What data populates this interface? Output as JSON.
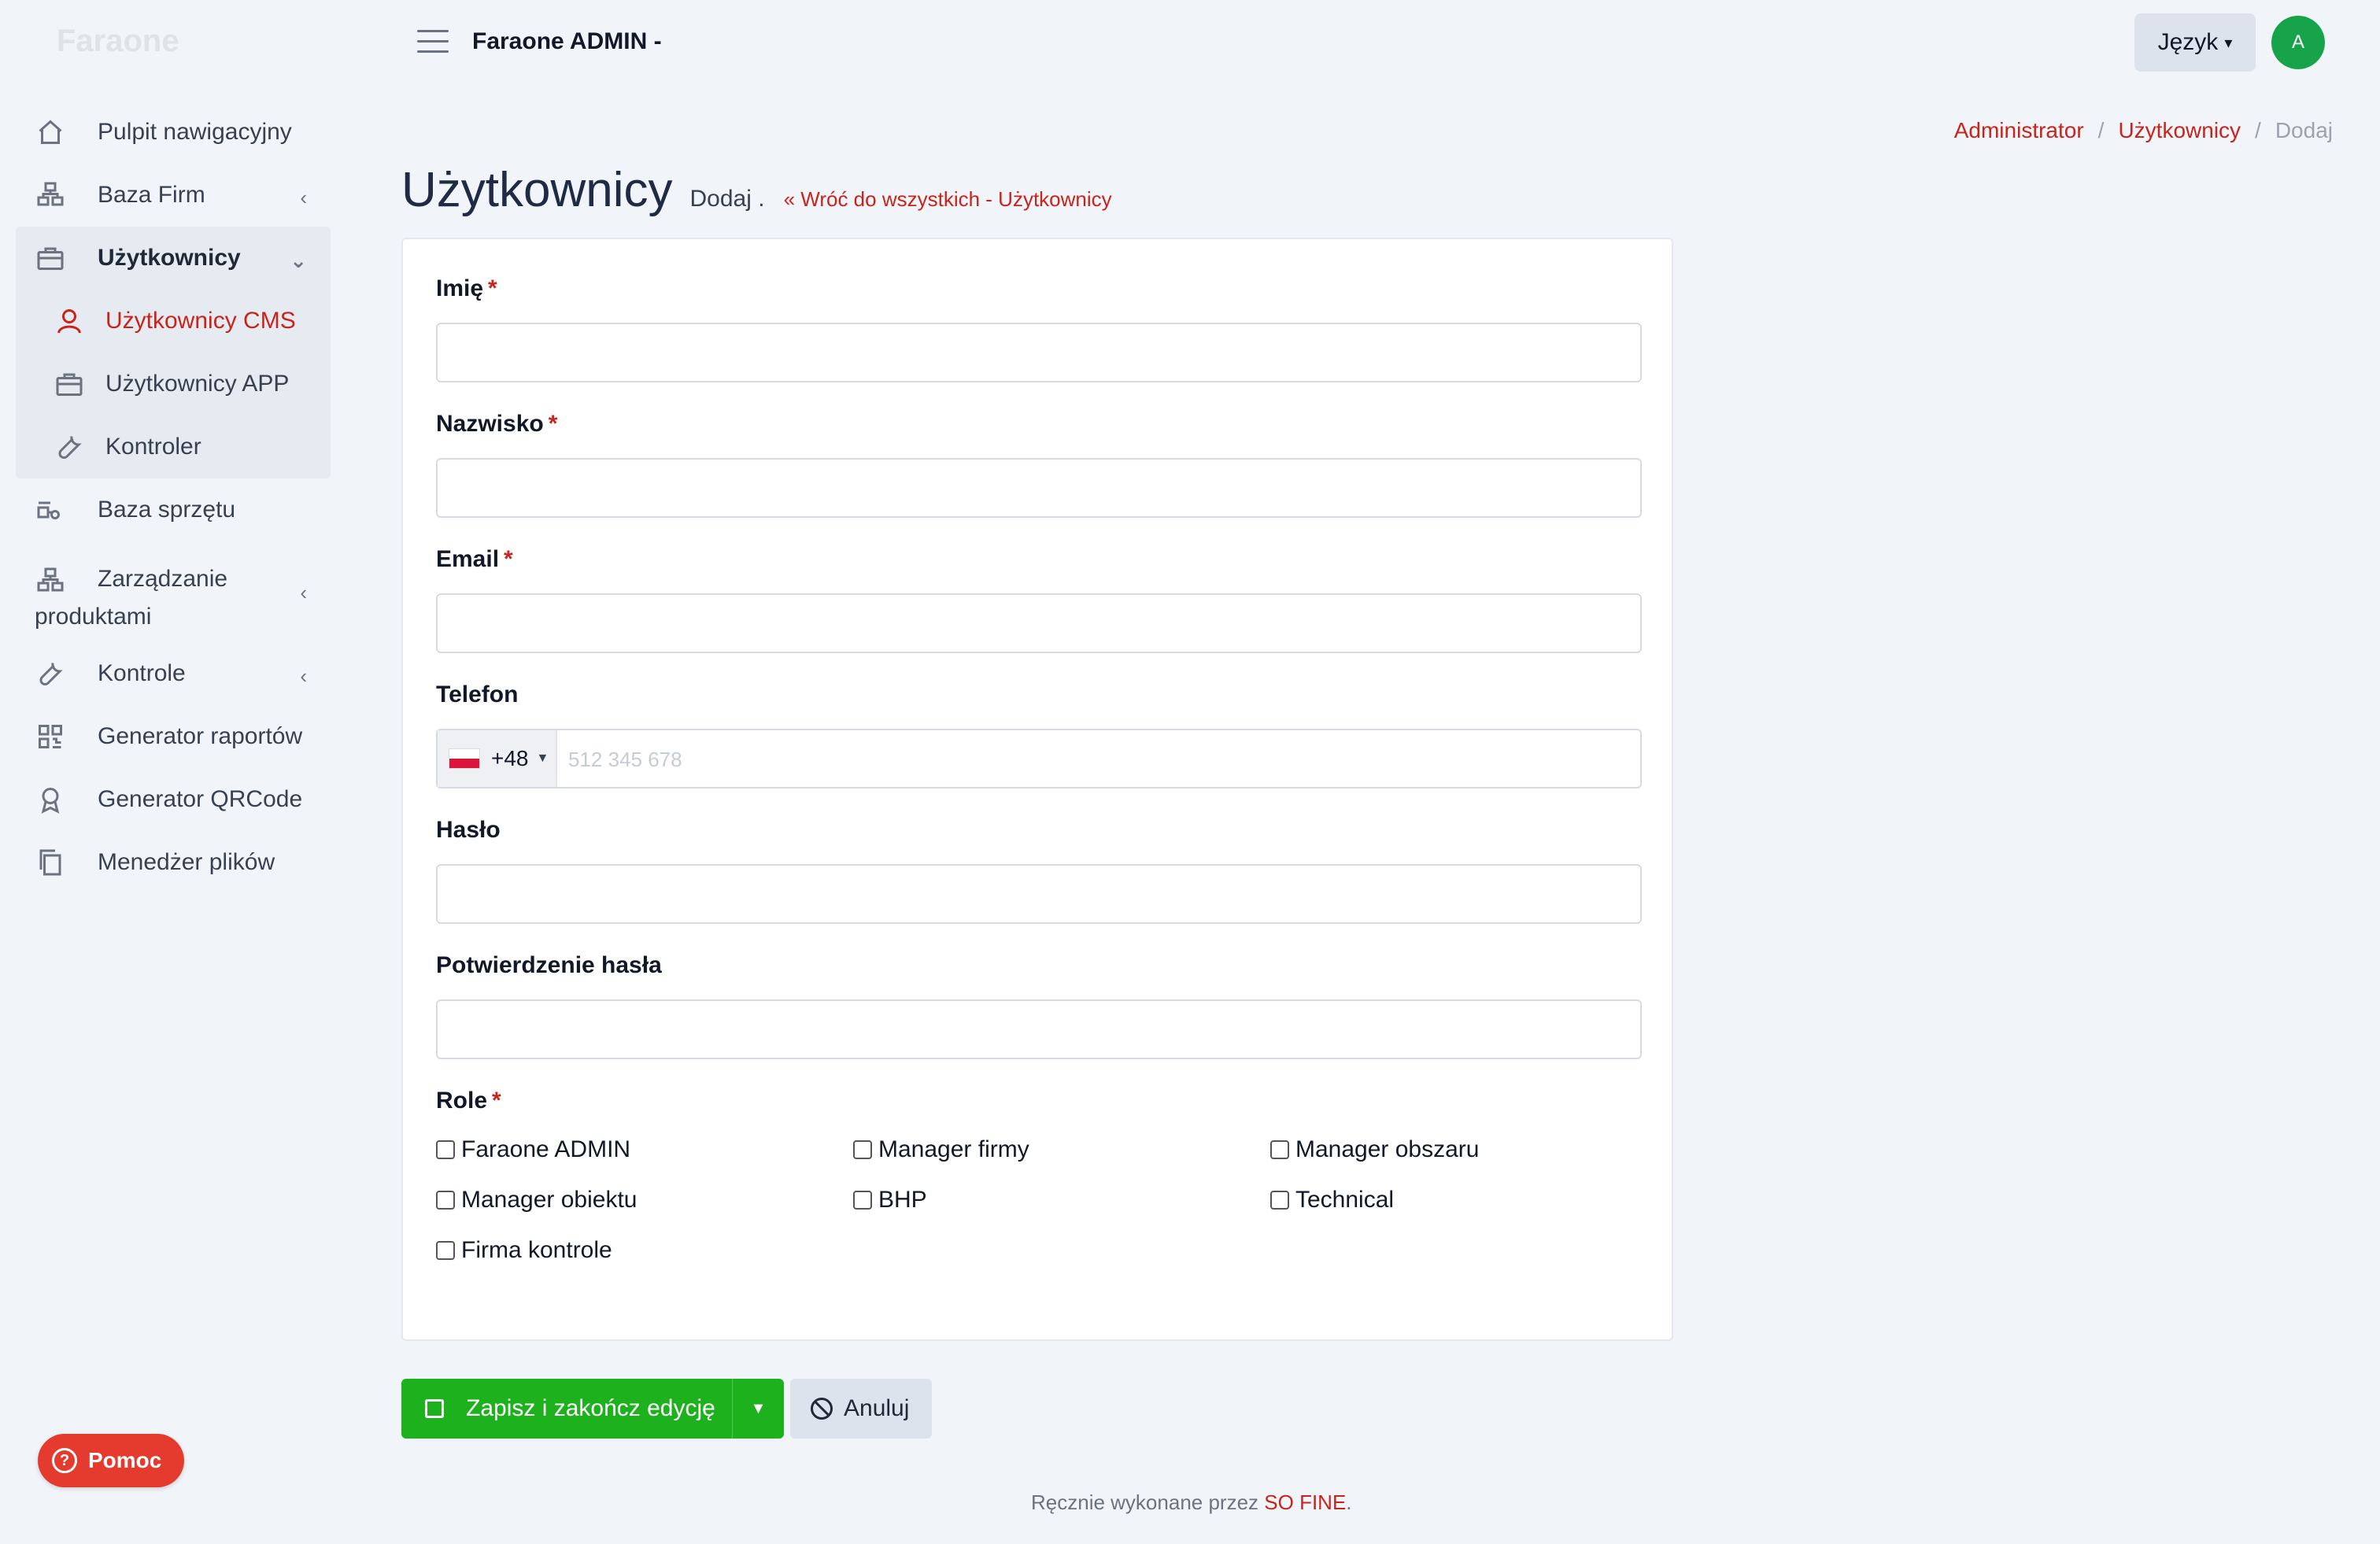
{
  "brand": "Faraone",
  "topbar": {
    "title": "Faraone ADMIN -",
    "language_label": "Język",
    "avatar_initial": "A"
  },
  "sidebar": {
    "items": [
      {
        "label": "Pulpit nawigacyjny",
        "icon": "home-icon"
      },
      {
        "label": "Baza Firm",
        "icon": "building-icon"
      },
      {
        "label": "Użytkownicy",
        "icon": "briefcase-icon"
      },
      {
        "label": "Użytkownicy CMS",
        "icon": "user-icon"
      },
      {
        "label": "Użytkownicy APP",
        "icon": "briefcase-icon"
      },
      {
        "label": "Kontroler",
        "icon": "wrench-icon"
      },
      {
        "label": "Baza sprzętu",
        "icon": "equipment-icon"
      },
      {
        "label": "Zarządzanie produktami",
        "icon": "building-icon"
      },
      {
        "label": "Kontrole",
        "icon": "wrench-icon"
      },
      {
        "label": "Generator raportów",
        "icon": "qr-icon"
      },
      {
        "label": "Generator QRCode",
        "icon": "award-icon"
      },
      {
        "label": "Menedżer plików",
        "icon": "files-icon"
      }
    ],
    "help_label": "Pomoc"
  },
  "breadcrumb": {
    "items": [
      "Administrator",
      "Użytkownicy",
      "Dodaj"
    ],
    "separator": "/"
  },
  "page": {
    "title": "Użytkownicy",
    "subtitle": "Dodaj .",
    "back_link": "Wróć do wszystkich - Użytkownicy"
  },
  "form": {
    "first_name_label": "Imię",
    "last_name_label": "Nazwisko",
    "email_label": "Email",
    "phone_label": "Telefon",
    "phone_prefix": "+48",
    "phone_placeholder": "512 345 678",
    "password_label": "Hasło",
    "password_confirm_label": "Potwierdzenie hasła",
    "roles_label": "Role",
    "required_mark": "*",
    "roles": [
      "Faraone ADMIN",
      "Manager firmy",
      "Manager obszaru",
      "Manager obiektu",
      "BHP",
      "Technical",
      "Firma kontrole"
    ]
  },
  "actions": {
    "save_label": "Zapisz i zakończ edycję",
    "cancel_label": "Anuluj"
  },
  "footer": {
    "text": "Ręcznie wykonane przez",
    "link": "SO FINE",
    "suffix": "."
  },
  "colors": {
    "accent": "#c8241c",
    "save": "#1db11d",
    "avatar": "#16a34a",
    "help": "#e43b2e"
  }
}
